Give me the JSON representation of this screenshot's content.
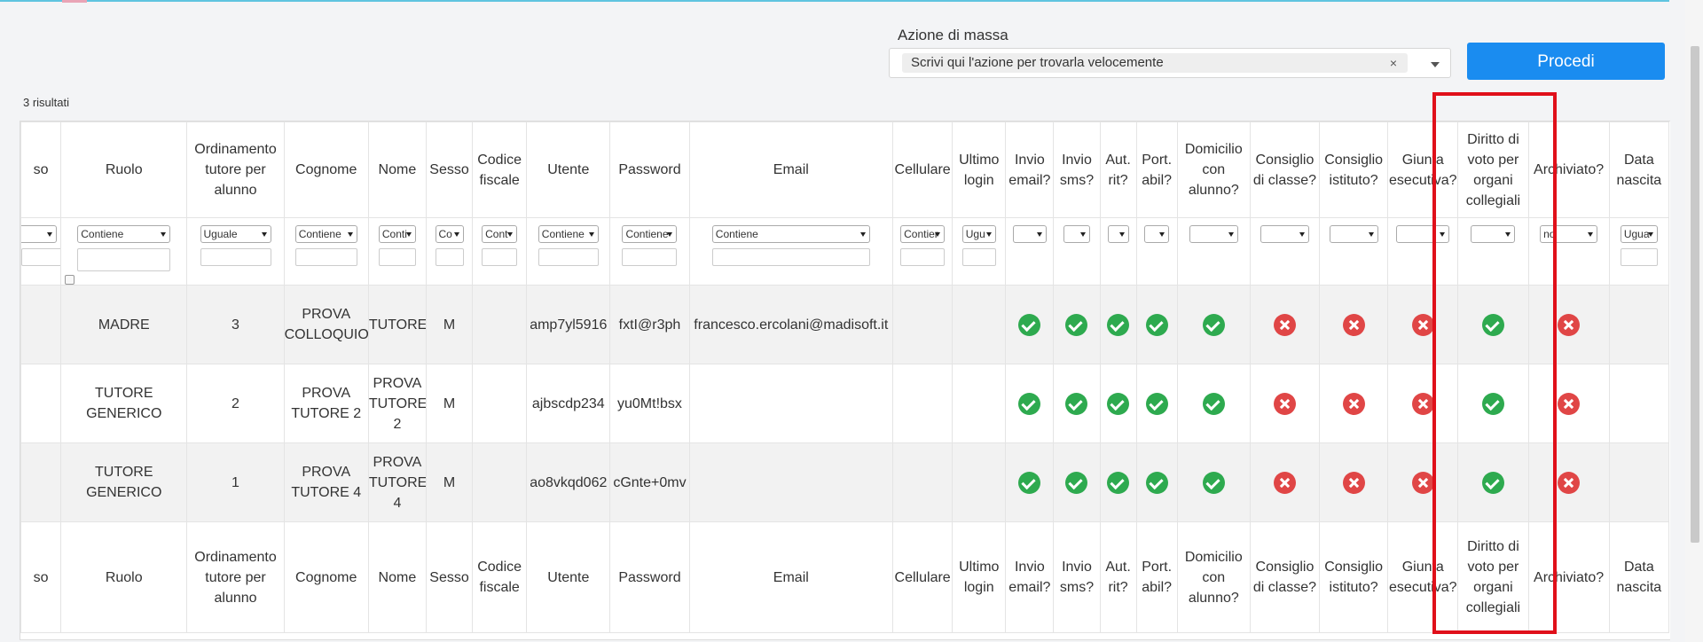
{
  "mass_action": {
    "label": "Azione di massa",
    "placeholder": "Scrivi qui l'azione per trovarla velocemente",
    "clear": "×",
    "submit_label": "Procedi"
  },
  "results_count": "3 risultati",
  "columns": [
    {
      "label": "so"
    },
    {
      "label": "Ruolo"
    },
    {
      "label": "Ordinamento tutore per alunno"
    },
    {
      "label": "Cognome"
    },
    {
      "label": "Nome"
    },
    {
      "label": "Sesso"
    },
    {
      "label": "Codice fiscale"
    },
    {
      "label": "Utente"
    },
    {
      "label": "Password"
    },
    {
      "label": "Email"
    },
    {
      "label": "Cellulare"
    },
    {
      "label": "Ultimo login"
    },
    {
      "label": "Invio email?"
    },
    {
      "label": "Invio sms?"
    },
    {
      "label": "Aut. rit?"
    },
    {
      "label": "Port. abil?"
    },
    {
      "label": "Domicilio con alunno?"
    },
    {
      "label": "Consiglio di classe?"
    },
    {
      "label": "Consiglio istituto?"
    },
    {
      "label": "Giunta esecutiva?"
    },
    {
      "label": "Diritto di voto per organi collegiali"
    },
    {
      "label": "Archiviato?"
    },
    {
      "label": "Data nascita"
    }
  ],
  "filters": [
    "",
    "Contiene",
    "Uguale",
    "Contiene",
    "Conti",
    "Co",
    "Cont",
    "Contiene",
    "Contiene",
    "Contiene",
    "Contier",
    "Ugu",
    "",
    "",
    "",
    "",
    "",
    "",
    "",
    "",
    "",
    "no",
    "Ugua"
  ],
  "rows": [
    {
      "cells": [
        "",
        "MADRE",
        "3",
        "PROVA COLLOQUIO",
        "TUTORE",
        "M",
        "",
        "amp7yl5916",
        "fxtI@r3ph",
        "francesco.ercolani@madisoft.it",
        "",
        ""
      ],
      "flags": [
        "ok",
        "ok",
        "ok",
        "ok",
        "ok",
        "ko",
        "ko",
        "ko",
        "ok",
        "ko"
      ]
    },
    {
      "cells": [
        "",
        "TUTORE GENERICO",
        "2",
        "PROVA TUTORE 2",
        "PROVA TUTORE 2",
        "M",
        "",
        "ajbscdp234",
        "yu0Mt!bsx",
        "",
        "",
        ""
      ],
      "flags": [
        "ok",
        "ok",
        "ok",
        "ok",
        "ok",
        "ko",
        "ko",
        "ko",
        "ok",
        "ko"
      ]
    },
    {
      "cells": [
        "",
        "TUTORE GENERICO",
        "1",
        "PROVA TUTORE 4",
        "PROVA TUTORE 4",
        "M",
        "",
        "ao8vkqd062",
        "cGnte+0mv",
        "",
        "",
        ""
      ],
      "flags": [
        "ok",
        "ok",
        "ok",
        "ok",
        "ok",
        "ko",
        "ko",
        "ko",
        "ok",
        "ko"
      ]
    }
  ],
  "flag_colors": {
    "ok": "#2eaa4f",
    "ko": "#e04646"
  },
  "primary_color": "#1a8cf0",
  "highlight_color": "#e0101a"
}
